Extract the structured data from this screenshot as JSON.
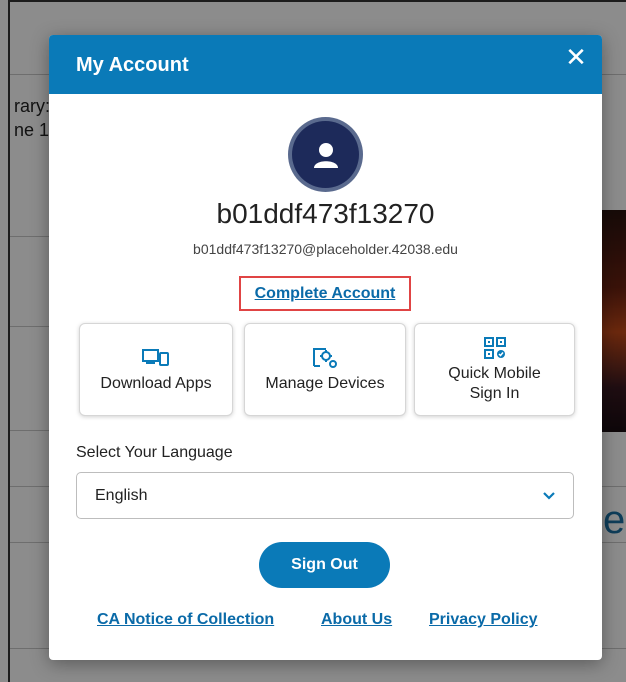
{
  "background": {
    "text_line1": "rary:",
    "text_line2": "ne 1",
    "partial_letter": "e"
  },
  "modal": {
    "title": "My Account",
    "close_label": "✕"
  },
  "profile": {
    "username": "b01ddf473f13270",
    "email": "b01ddf473f13270@placeholder.42038.edu",
    "complete_account_label": "Complete Account"
  },
  "tiles": [
    {
      "label": "Download Apps",
      "icon": "devices-icon"
    },
    {
      "label": "Manage Devices",
      "icon": "device-settings-icon"
    },
    {
      "label_line1": "Quick Mobile",
      "label_line2": "Sign In",
      "icon": "qr-code-icon"
    }
  ],
  "language": {
    "label": "Select Your Language",
    "selected": "English"
  },
  "sign_out_label": "Sign Out",
  "footer": {
    "ca_notice": "CA Notice of Collection",
    "about_us": "About Us",
    "privacy_policy": "Privacy Policy"
  },
  "colors": {
    "brand": "#0a7ab8",
    "link": "#0a6aa8",
    "highlight_border": "#e04444",
    "avatar_bg": "#1d2a5a"
  }
}
